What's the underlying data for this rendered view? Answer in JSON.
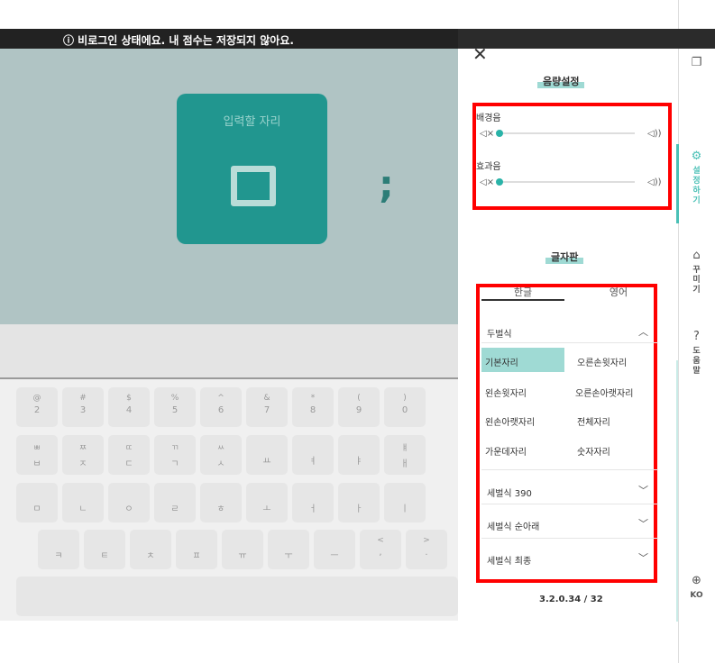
{
  "banner": {
    "icon": "warning-circle-icon",
    "text": "ⓘ 비로그인 상태에요. 내 점수는 저장되지 않아요."
  },
  "game": {
    "input_card_label": "입력할 자리",
    "next_char": ";"
  },
  "keyboard": {
    "row1": [
      [
        "@",
        "2"
      ],
      [
        "#",
        "3"
      ],
      [
        "$",
        "4"
      ],
      [
        "%",
        "5"
      ],
      [
        "^",
        "6"
      ],
      [
        "&",
        "7"
      ],
      [
        "*",
        "8"
      ],
      [
        "(",
        "9"
      ],
      [
        ")",
        "0"
      ],
      [
        "_",
        "-"
      ]
    ],
    "row2": [
      [
        "ㅃ",
        "ㅂ"
      ],
      [
        "ㅉ",
        "ㅈ"
      ],
      [
        "ㄸ",
        "ㄷ"
      ],
      [
        "ㄲ",
        "ㄱ"
      ],
      [
        "ㅆ",
        "ㅅ"
      ],
      [
        "",
        "ㅛ"
      ],
      [
        "",
        "ㅕ"
      ],
      [
        "",
        "ㅑ"
      ],
      [
        "ㅒ",
        "ㅐ"
      ],
      [
        "ㅖ",
        "ㅔ"
      ]
    ],
    "row3": [
      [
        "",
        "ㅁ"
      ],
      [
        "",
        "ㄴ"
      ],
      [
        "",
        "ㅇ"
      ],
      [
        "",
        "ㄹ"
      ],
      [
        "",
        "ㅎ"
      ],
      [
        "",
        "ㅗ"
      ],
      [
        "",
        "ㅓ"
      ],
      [
        "",
        "ㅏ"
      ],
      [
        "",
        "ㅣ"
      ],
      [
        ":",
        ";"
      ]
    ],
    "row4": [
      [
        "",
        "ㅋ"
      ],
      [
        "",
        "ㅌ"
      ],
      [
        "",
        "ㅊ"
      ],
      [
        "",
        "ㅍ"
      ],
      [
        "",
        "ㅠ"
      ],
      [
        "",
        "ㅜ"
      ],
      [
        "",
        "ㅡ"
      ],
      [
        "<",
        ","
      ],
      [
        ">",
        "."
      ]
    ]
  },
  "panel": {
    "close": "✕",
    "sound": {
      "title": "음량설정",
      "bgm_label": "배경음",
      "sfx_label": "효과음",
      "mute_icon": "speaker-mute-icon",
      "loud_icon": "speaker-loud-icon",
      "mute_glyph": "◁×",
      "loud_glyph": "◁))",
      "bgm_level": 0,
      "sfx_level": 0
    },
    "layout": {
      "title": "글자판",
      "tabs": [
        "한글",
        "영어"
      ],
      "active_tab": "한글",
      "sections": [
        {
          "label": "두벌식",
          "expanded": true
        },
        {
          "label": "세벌식 390",
          "expanded": false
        },
        {
          "label": "세벌식 순아래",
          "expanded": false
        },
        {
          "label": "세벌식 최종",
          "expanded": false
        }
      ],
      "options": [
        "기본자리",
        "오른손윗자리",
        "왼손윗자리",
        "오른손아랫자리",
        "왼손아랫자리",
        "전체자리",
        "가운데자리",
        "숫자자리"
      ],
      "selected_option": "기본자리"
    },
    "version": "3.2.0.34 / 32"
  },
  "rail": {
    "copy_icon": "copy-icon",
    "settings": {
      "icon": "gear-icon",
      "label": [
        "설",
        "정",
        "하",
        "기"
      ]
    },
    "decorate": {
      "icon": "brush-icon",
      "label": [
        "꾸",
        "미",
        "기"
      ]
    },
    "help": {
      "icon": "help-circle-icon",
      "label": [
        "도",
        "움",
        "말"
      ]
    },
    "language": {
      "icon": "globe-icon",
      "label": "KO"
    }
  }
}
